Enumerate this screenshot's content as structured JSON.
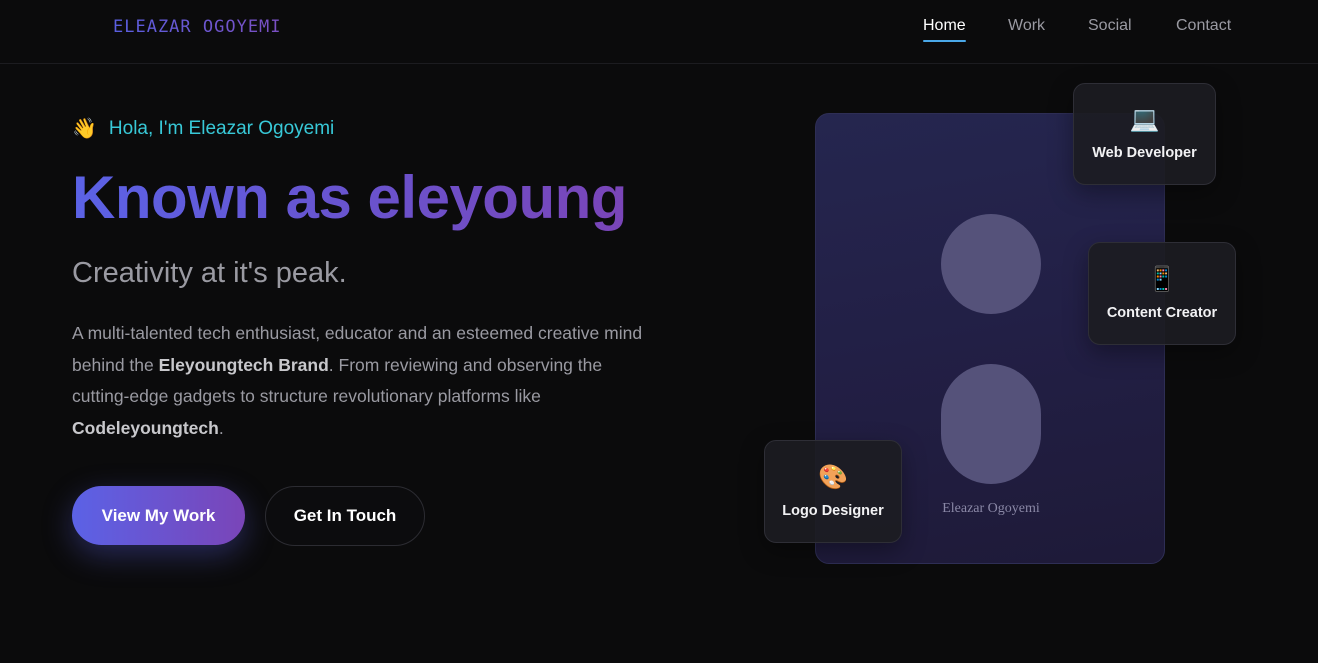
{
  "nav": {
    "logo": "ELEAZAR OGOYEMI",
    "links": [
      {
        "label": "Home",
        "active": true
      },
      {
        "label": "Work",
        "active": false
      },
      {
        "label": "Social",
        "active": false
      },
      {
        "label": "Contact",
        "active": false
      }
    ]
  },
  "hero": {
    "greeting_icon": "👋",
    "greeting": "Hola, I'm Eleazar Ogoyemi",
    "headline": "Known as eleyoung",
    "tagline": "Creativity at it's peak.",
    "bio": {
      "part1": "A multi-talented tech enthusiast, educator and an esteemed creative mind behind the ",
      "brand": "Eleyoungtech Brand",
      "part2": ". From reviewing and observing the cutting-edge gadgets to structure revolutionary platforms like ",
      "platform": "Codeleyoungtech",
      "part3": "."
    },
    "primary_button": "View My Work",
    "secondary_button": "Get In Touch"
  },
  "profile_card": {
    "name": "Eleazar Ogoyemi"
  },
  "roles": [
    {
      "icon": "💻",
      "icon_name": "laptop-icon",
      "label": "Web Developer"
    },
    {
      "icon": "📱",
      "icon_name": "mobile-phone-icon",
      "label": "Content Creator"
    },
    {
      "icon": "🎨",
      "icon_name": "palette-icon",
      "label": "Logo Designer"
    }
  ],
  "colors": {
    "background": "#0b0b0c",
    "accent_start": "#5b62e6",
    "accent_end": "#7a45b8",
    "greeting": "#38c9d8",
    "nav_underline": "#4aa8e8"
  }
}
